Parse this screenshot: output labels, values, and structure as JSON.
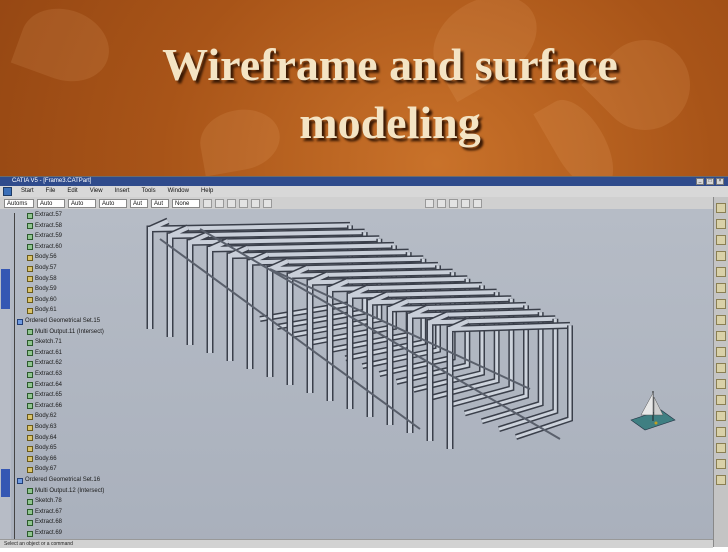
{
  "slide": {
    "title_line1": "Wireframe and surface",
    "title_line2": "modeling"
  },
  "app": {
    "window_title": "CATIA V5 - [Frame3.CATPart]",
    "menu": [
      "Start",
      "File",
      "Edit",
      "View",
      "Insert",
      "Tools",
      "Window",
      "Help"
    ],
    "toolbar_combos": [
      "Automs",
      "Auto",
      "Auto",
      "Auto",
      "Aut",
      "Aut",
      "None"
    ],
    "status_text": "Select an object or a command"
  },
  "tree": [
    {
      "label": "Extract.57",
      "type": "feature"
    },
    {
      "label": "Extract.58",
      "type": "feature"
    },
    {
      "label": "Extract.59",
      "type": "feature"
    },
    {
      "label": "Extract.60",
      "type": "feature"
    },
    {
      "label": "Body.56",
      "type": "body"
    },
    {
      "label": "Body.57",
      "type": "body"
    },
    {
      "label": "Body.58",
      "type": "body"
    },
    {
      "label": "Body.59",
      "type": "body"
    },
    {
      "label": "Body.60",
      "type": "body"
    },
    {
      "label": "Body.61",
      "type": "body"
    },
    {
      "label": "Ordered Geometrical Set.15",
      "type": "set"
    },
    {
      "label": "Multi Output.11 (Intersect)",
      "type": "feature"
    },
    {
      "label": "Sketch.71",
      "type": "feature"
    },
    {
      "label": "Extract.61",
      "type": "feature"
    },
    {
      "label": "Extract.62",
      "type": "feature"
    },
    {
      "label": "Extract.63",
      "type": "feature"
    },
    {
      "label": "Extract.64",
      "type": "feature"
    },
    {
      "label": "Extract.65",
      "type": "feature"
    },
    {
      "label": "Extract.66",
      "type": "feature"
    },
    {
      "label": "Body.62",
      "type": "body"
    },
    {
      "label": "Body.63",
      "type": "body"
    },
    {
      "label": "Body.64",
      "type": "body"
    },
    {
      "label": "Body.65",
      "type": "body"
    },
    {
      "label": "Body.66",
      "type": "body"
    },
    {
      "label": "Body.67",
      "type": "body"
    },
    {
      "label": "Ordered Geometrical Set.16",
      "type": "set"
    },
    {
      "label": "Multi Output.12 (Intersect)",
      "type": "feature"
    },
    {
      "label": "Sketch.78",
      "type": "feature"
    },
    {
      "label": "Extract.67",
      "type": "feature"
    },
    {
      "label": "Extract.68",
      "type": "feature"
    },
    {
      "label": "Extract.69",
      "type": "feature"
    }
  ],
  "icons": {
    "compass": "compass-icon",
    "app": "catia-icon"
  }
}
